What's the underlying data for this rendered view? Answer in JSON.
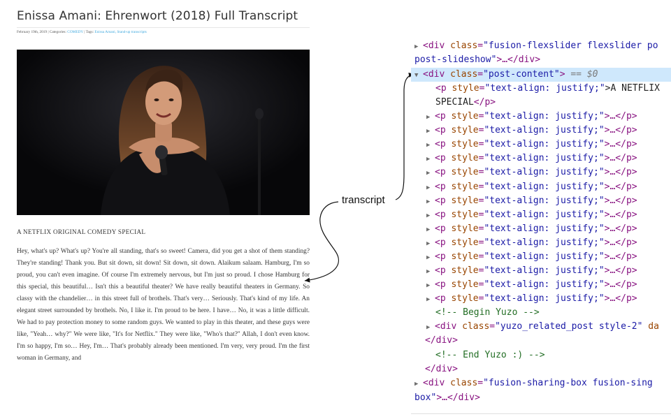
{
  "post": {
    "title": "Enissa Amani: Ehrenwort (2018) Full Transcript",
    "date": "February 19th, 2019",
    "categories_label": "Categories:",
    "category": "COMEDY",
    "tags_label": "Tags:",
    "tags": "Enissa Amani, Stand-up transcripts",
    "subheading": "A NETFLIX ORIGINAL COMEDY SPECIAL",
    "paragraph": "Hey, what's up? What's up? You're all standing, that's so sweet! Camera, did you get a shot of them standing? They're standing! Thank you. But sit down, sit down! Sit down, sit down. Alaikum salaam. Hamburg, I'm so proud, you can't even imagine. Of course I'm extremely nervous, but I'm just so proud. I chose Hamburg for this special, this beautiful… Isn't this a beautiful theater? We have really beautiful theaters in Germany. So classy with the chandelier… in this street full of brothels. That's very… Seriously. That's kind of my life. An elegant street surrounded by brothels. No, I like it. I'm proud to be here. I have… No, it was a little difficult. We had to pay protection money to some random guys. We wanted to play in this theater, and these guys were like, \"Yeah… why?\" We were like, \"It's for Netflix.\" They were like, \"Who's that?\" Allah, I don't even know. I'm so happy, I'm so… Hey, I'm… That's probably already been mentioned. I'm very, very proud. I'm the first woman in Germany, and"
  },
  "annotation": {
    "label": "transcript"
  },
  "devtools": {
    "line1_tag": "<div ",
    "line1_attr": "class",
    "line1_val": "\"fusion-flexslider flexslider po",
    "line2_val": "post-slideshow\"",
    "line2_rest": ">…</div>",
    "sel_open": "<div ",
    "sel_attr": "class",
    "sel_val": "\"post-content\"",
    "sel_close": ">",
    "sel_marker": "== $0",
    "p_open": "<p ",
    "p_attr": "style",
    "p_val": "\"text-align: justify;\"",
    "first_p_text": ">A NETFLIX",
    "first_p_cont": "SPECIAL",
    "first_p_end": "</p>",
    "collapsed_rest": ">…</p>",
    "comment_begin": "<!-- Begin Yuzo -->",
    "yuzo_open": "<div ",
    "yuzo_attr": "class",
    "yuzo_val": "\"yuzo_related_post style-2\"",
    "yuzo_tail": " da",
    "yuzo_close": "</div>",
    "comment_end": "<!-- End Yuzo :) -->",
    "div_close": "</div>",
    "share_open": "<div ",
    "share_attr": "class",
    "share_val": "\"fusion-sharing-box fusion-sing",
    "share_cont": "box\"",
    "share_rest": ">…</div>"
  },
  "colors": {
    "link": "#3ea8de",
    "tag": "#881280",
    "attr_name": "#994500",
    "attr_value": "#1a1aa6",
    "comment": "#236e25",
    "selection": "#cfe8fc"
  }
}
